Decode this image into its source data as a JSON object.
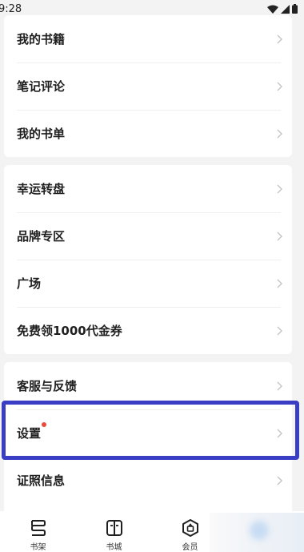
{
  "status_bar": {
    "time": "9:28"
  },
  "group1": [
    {
      "label": "我的书籍"
    },
    {
      "label": "笔记评论"
    },
    {
      "label": "我的书单"
    }
  ],
  "group2": [
    {
      "label": "幸运转盘"
    },
    {
      "label": "品牌专区"
    },
    {
      "label": "广场"
    },
    {
      "label": "免费领1000代金券"
    }
  ],
  "group3": [
    {
      "label": "客服与反馈"
    },
    {
      "label": "设置",
      "badge": true
    },
    {
      "label": "证照信息"
    }
  ],
  "tabs": [
    {
      "label": "书架",
      "icon": "bookshelf-icon"
    },
    {
      "label": "书城",
      "icon": "book-store-icon"
    },
    {
      "label": "会员",
      "icon": "membership-icon"
    }
  ],
  "colors": {
    "background": "#f3f3f3",
    "highlight": "#3a3ec4",
    "badge": "#ea4a3c"
  }
}
